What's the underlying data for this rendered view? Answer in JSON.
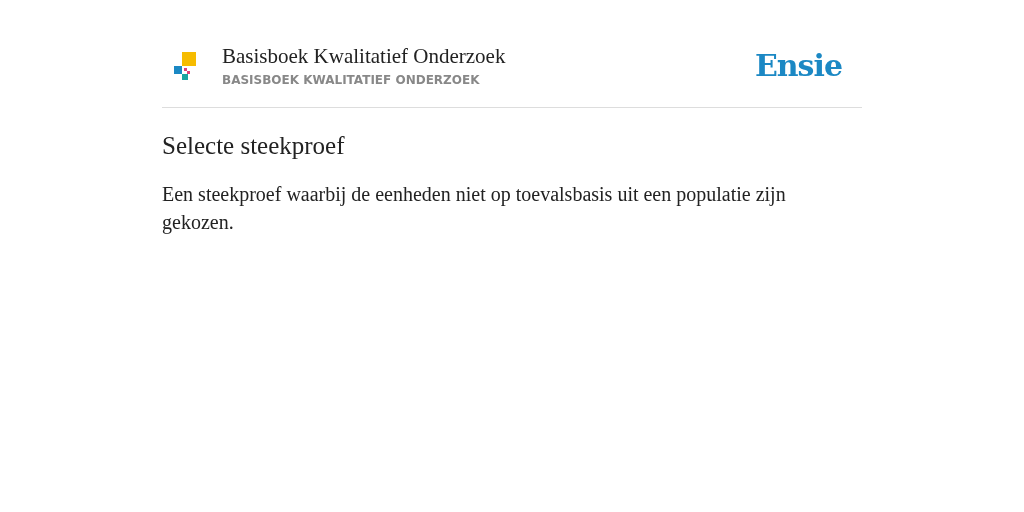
{
  "header": {
    "title": "Basisboek Kwalitatief Onderzoek",
    "subtitle": "BASISBOEK KWALITATIEF ONDERZOEK",
    "brand": "Ensie"
  },
  "entry": {
    "term": "Selecte steekproef",
    "definition": "Een steekproef waarbij de eenheden niet op toevalsbasis uit een populatie zijn gekozen."
  }
}
